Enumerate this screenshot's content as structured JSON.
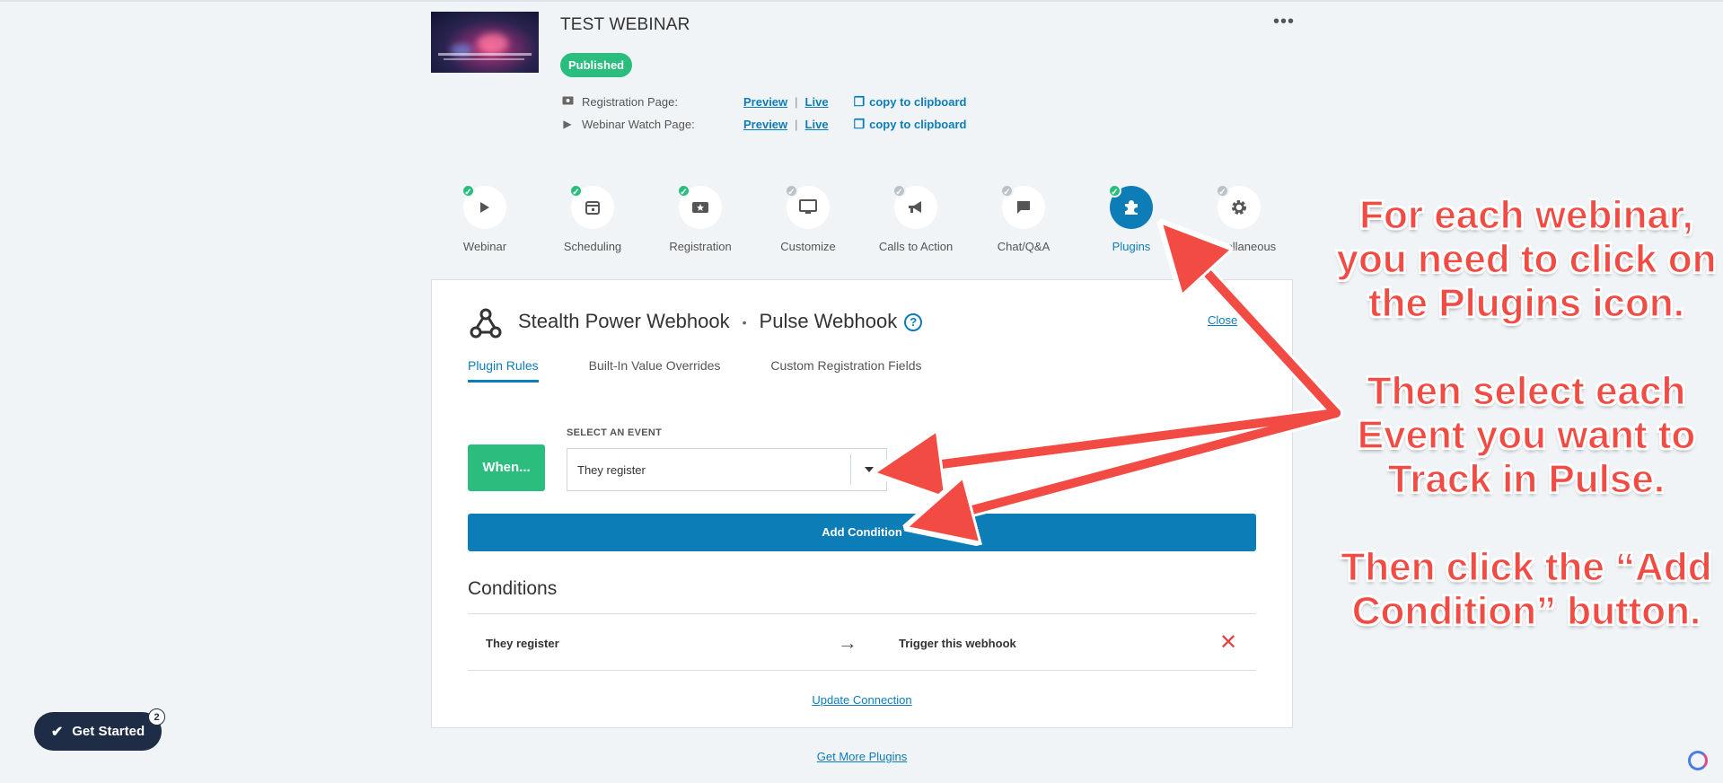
{
  "webinar": {
    "title": "TEST WEBINAR",
    "status": "Published",
    "more_label": "•••"
  },
  "pages": [
    {
      "label": "Registration Page:",
      "preview": "Preview",
      "sep": "|",
      "live": "Live",
      "copy": "copy to clipboard",
      "icon": "ticket-icon"
    },
    {
      "label": "Webinar Watch Page:",
      "preview": "Preview",
      "sep": "|",
      "live": "Live",
      "copy": "copy to clipboard",
      "icon": "play-icon"
    }
  ],
  "steps": [
    {
      "label": "Webinar",
      "icon": "play-icon",
      "checked": true
    },
    {
      "label": "Scheduling",
      "icon": "calendar-icon",
      "checked": true
    },
    {
      "label": "Registration",
      "icon": "ticket-star-icon",
      "checked": true
    },
    {
      "label": "Customize",
      "icon": "monitor-icon",
      "checked": false
    },
    {
      "label": "Calls to Action",
      "icon": "megaphone-icon",
      "checked": false
    },
    {
      "label": "Chat/Q&A",
      "icon": "chat-icon",
      "checked": false
    },
    {
      "label": "Plugins",
      "icon": "puzzle-icon",
      "checked": true,
      "active": true
    },
    {
      "label": "Miscellaneous",
      "icon": "gear-icon",
      "checked": false
    }
  ],
  "plugin": {
    "name": "Stealth Power Webhook",
    "dot": "•",
    "connection": "Pulse Webhook",
    "help": "?",
    "close": "Close",
    "tabs": [
      "Plugin Rules",
      "Built-In Value Overrides",
      "Custom Registration Fields"
    ],
    "when_label": "When...",
    "event_label": "SELECT AN EVENT",
    "event_value": "They register",
    "add_condition": "Add Condition",
    "conditions_title": "Conditions",
    "conditions": [
      {
        "event": "They register",
        "action": "Trigger this webhook"
      }
    ],
    "update_connection": "Update Connection"
  },
  "get_more_plugins": "Get More Plugins",
  "get_started": {
    "label": "Get Started",
    "count": "2"
  },
  "annotation": {
    "block1": [
      "For each webinar,",
      "you need to click on",
      "the Plugins icon."
    ],
    "block2": [
      "Then select each",
      "Event you want to",
      "Track in Pulse."
    ],
    "block3": [
      "Then click the “Add",
      "Condition” button."
    ]
  },
  "colors": {
    "accent_blue": "#0d7db8",
    "success_green": "#2bbd7e",
    "annotation_red": "#f24b44",
    "delete_red": "#e04444"
  }
}
